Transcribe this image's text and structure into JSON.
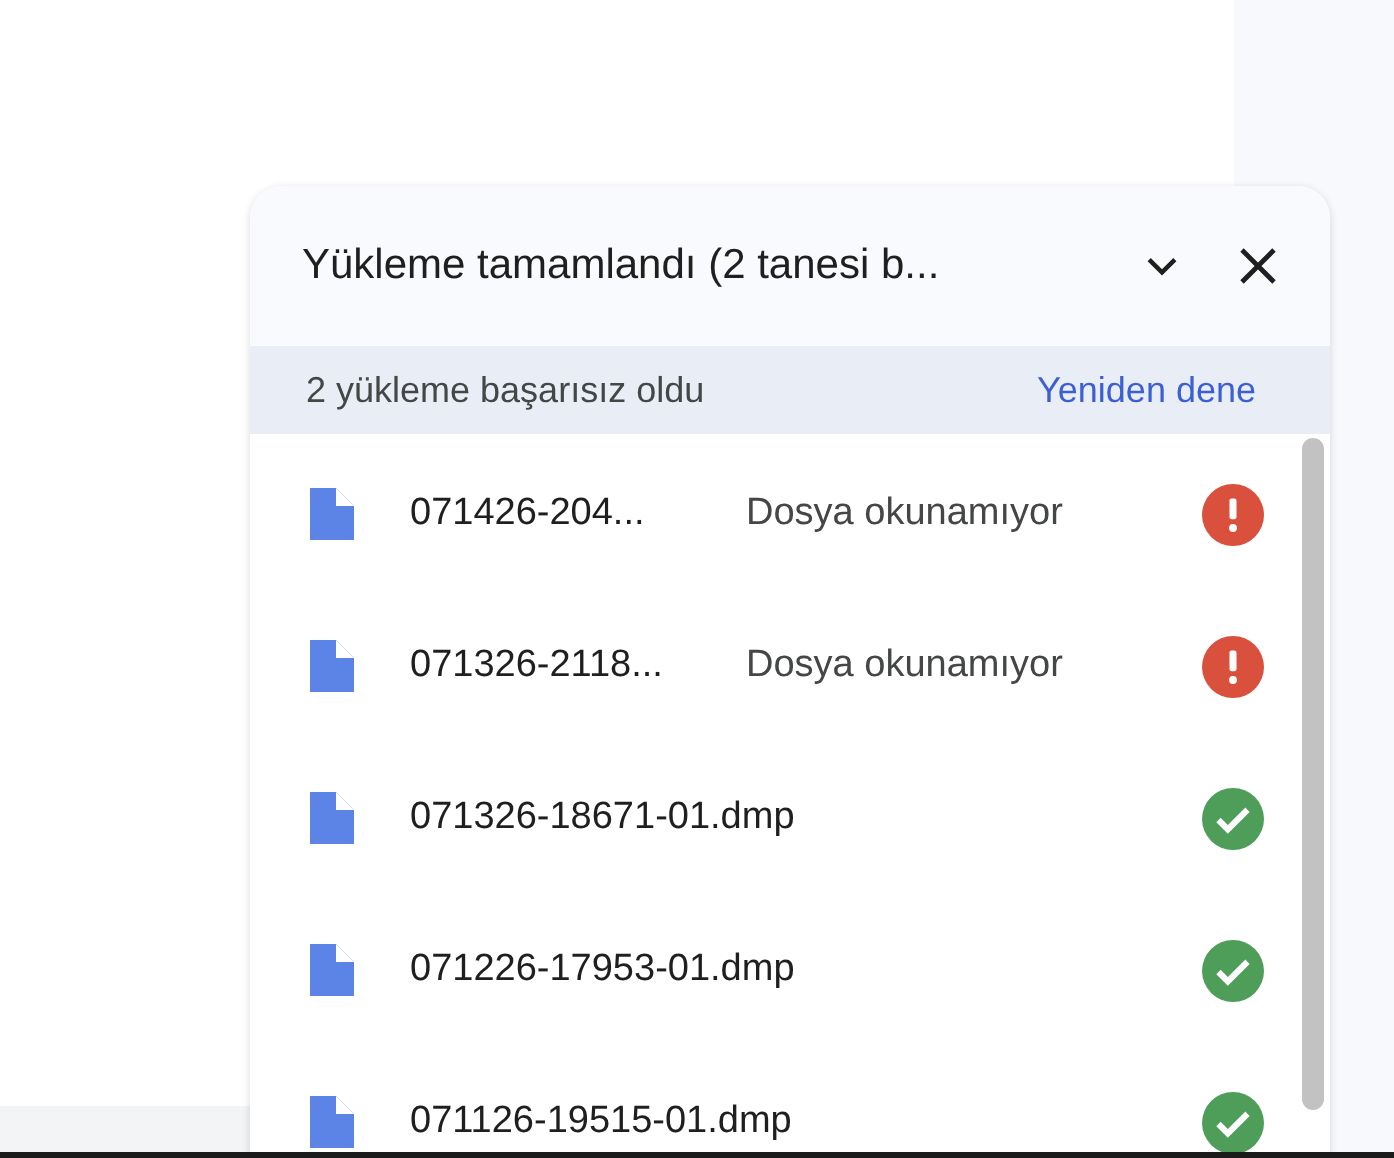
{
  "panel": {
    "title": "Yükleme tamamlandı (2 tanesi b...",
    "failed_bar": {
      "text": "2 yükleme başarısız oldu",
      "action": "Yeniden dene"
    },
    "uploads": [
      {
        "name": "071426-204...",
        "message": "Dosya okunamıyor",
        "kind": "error"
      },
      {
        "name": "071326-2118...",
        "message": "Dosya okunamıyor",
        "kind": "error"
      },
      {
        "name": "071326-18671-01.dmp",
        "kind": "done"
      },
      {
        "name": "071226-17953-01.dmp",
        "kind": "done"
      },
      {
        "name": "071126-19515-01.dmp",
        "kind": "done"
      }
    ]
  }
}
